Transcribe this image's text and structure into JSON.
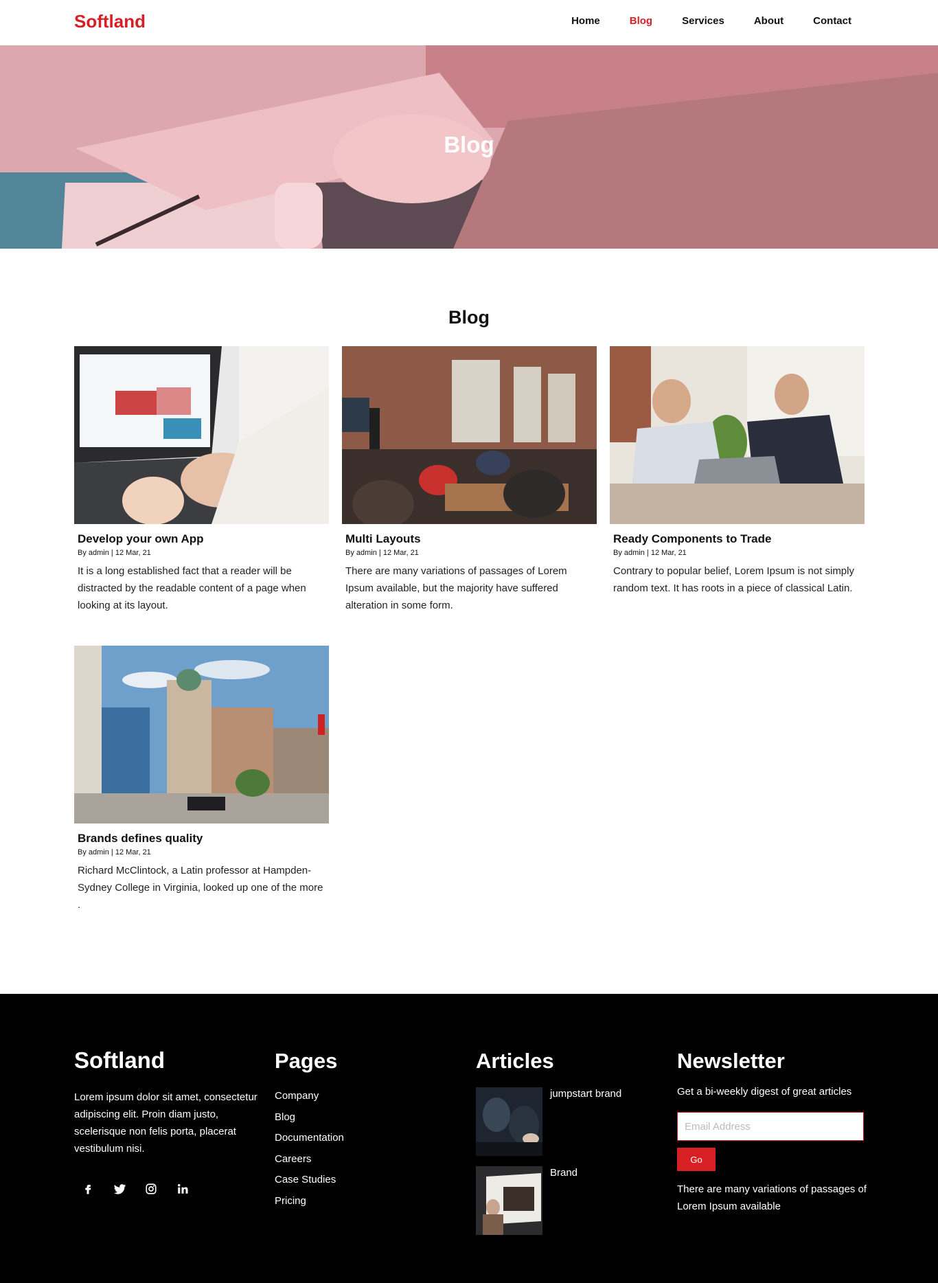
{
  "brand": "Softland",
  "nav": {
    "items": [
      {
        "label": "Home"
      },
      {
        "label": "Blog"
      },
      {
        "label": "Services"
      },
      {
        "label": "About"
      },
      {
        "label": "Contact"
      }
    ],
    "active": "Blog"
  },
  "hero": {
    "title": "Blog"
  },
  "blog": {
    "heading": "Blog",
    "posts": [
      {
        "title": "Develop your own App",
        "meta": "By admin | 12 Mar, 21",
        "excerpt": "It is a long established fact that a reader will be distracted by the readable content of a page when looking at its layout."
      },
      {
        "title": "Multi Layouts",
        "meta": "By admin | 12 Mar, 21",
        "excerpt": "There are many variations of passages of Lorem Ipsum available, but the majority have suffered alteration in some form."
      },
      {
        "title": "Ready Components to Trade",
        "meta": "By admin | 12 Mar, 21",
        "excerpt": "Contrary to popular belief, Lorem Ipsum is not simply random text. It has roots in a piece of classical Latin."
      },
      {
        "title": "Brands defines quality",
        "meta": "By admin | 12 Mar, 21",
        "excerpt": "Richard McClintock, a Latin professor at Hampden-Sydney College in Virginia, looked up one of the more ."
      }
    ]
  },
  "footer": {
    "brand": "Softland",
    "about": "Lorem ipsum dolor sit amet, consectetur adipiscing elit. Proin diam justo, scelerisque non felis porta, placerat vestibulum nisi.",
    "social_icons": [
      "facebook-icon",
      "twitter-icon",
      "instagram-icon",
      "linkedin-icon"
    ],
    "pages_heading": "Pages",
    "pages": [
      "Company",
      "Blog",
      "Documentation",
      "Careers",
      "Case Studies",
      "Pricing"
    ],
    "articles_heading": "Articles",
    "articles": [
      {
        "title": "jumpstart brand"
      },
      {
        "title": "Brand"
      }
    ],
    "newsletter_heading": "Newsletter",
    "newsletter_text": "Get a bi-weekly digest of great articles",
    "email_placeholder": "Email Address",
    "go_label": "Go",
    "newsletter_note": "There are many variations of passages of Lorem Ipsum available"
  },
  "colors": {
    "accent": "#d71f26",
    "footer_bg": "#000000"
  }
}
